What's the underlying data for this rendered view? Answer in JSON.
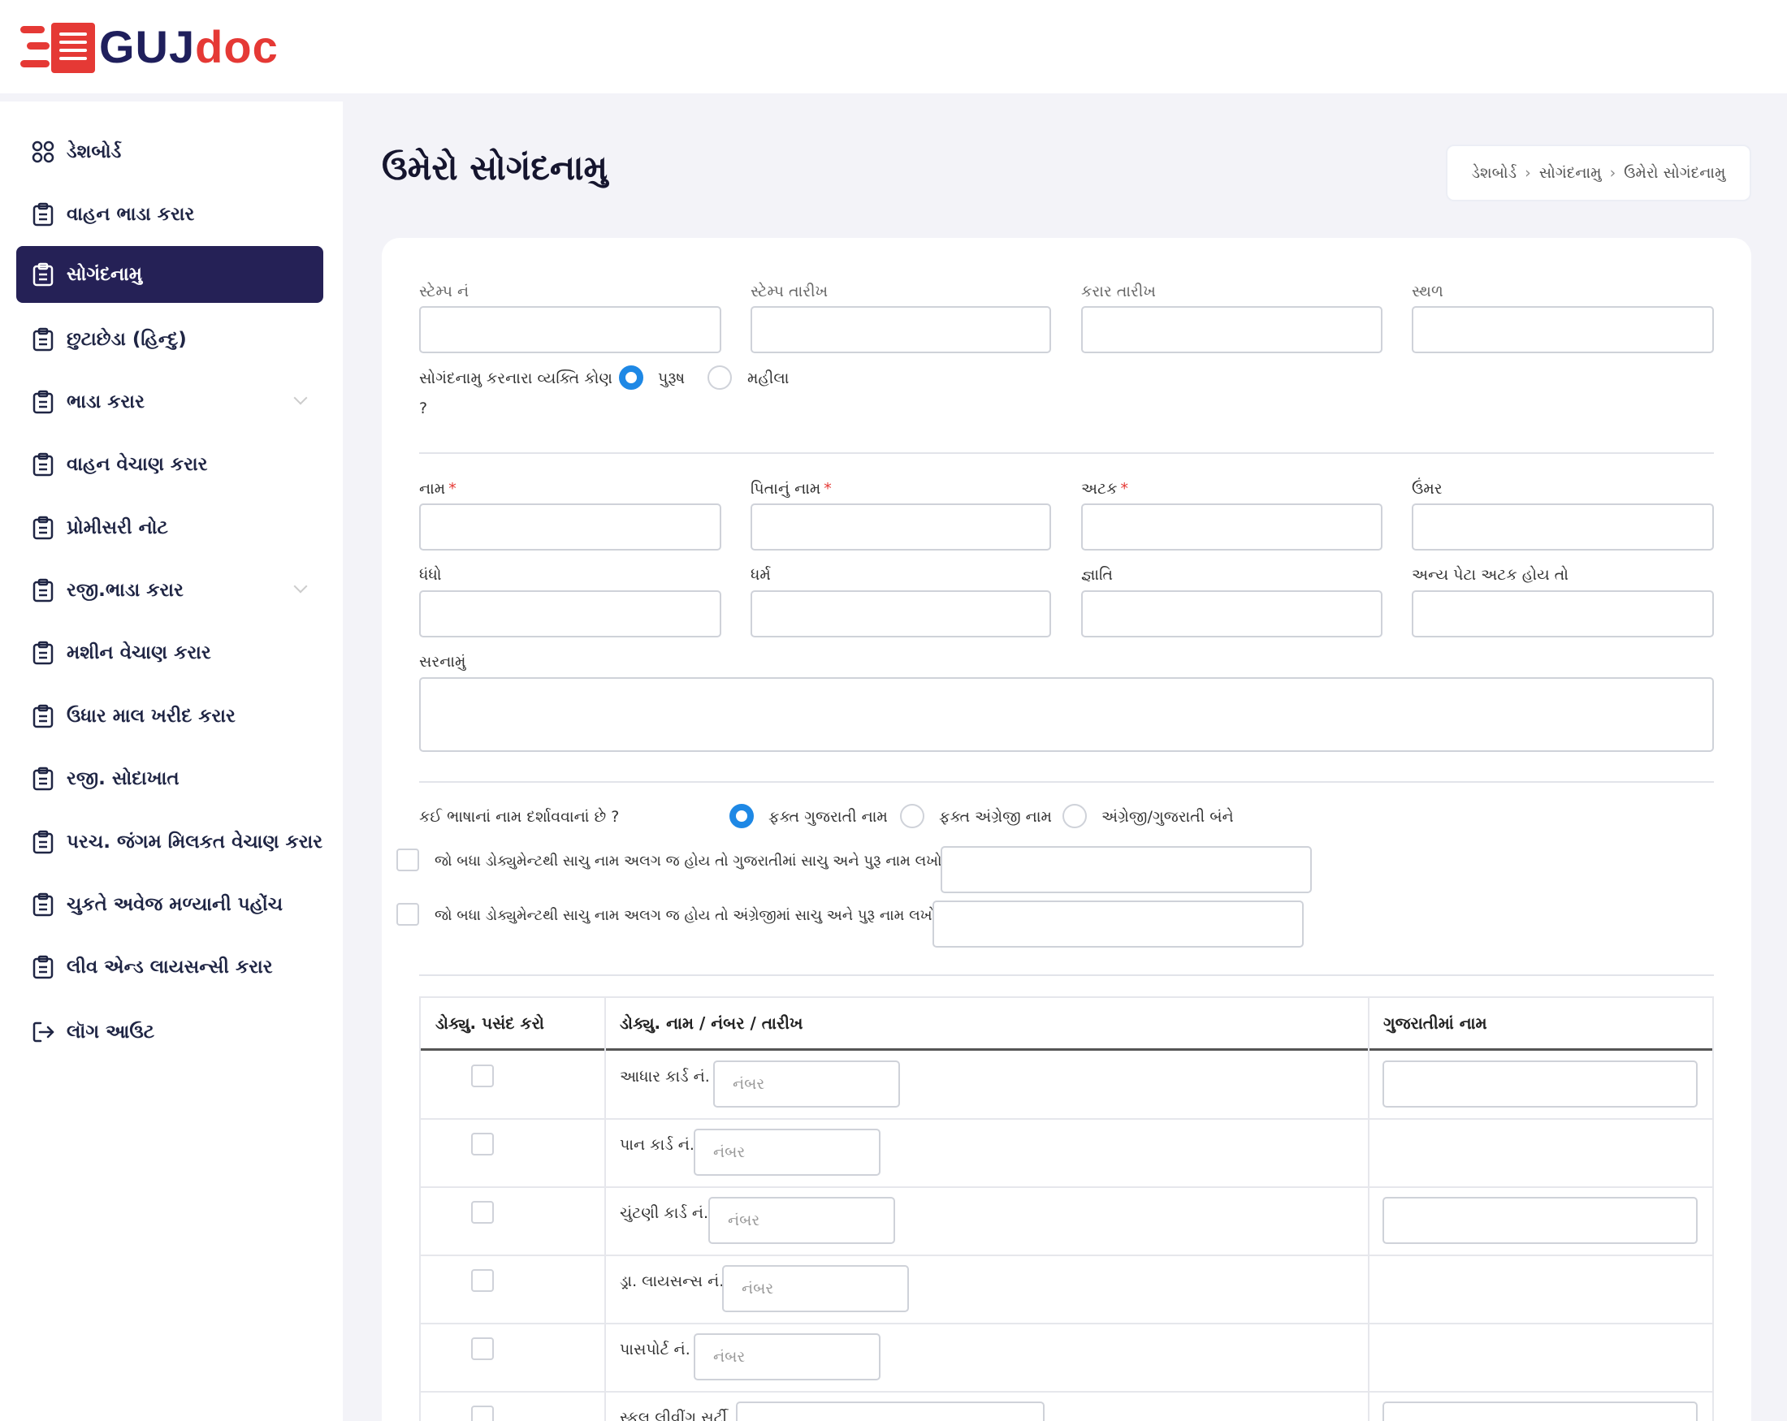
{
  "brand": {
    "name_part1": "GUJ",
    "name_part2": "doc",
    "color_dark": "#1f1f5c",
    "color_red": "#e53935"
  },
  "sidebar": {
    "items": [
      {
        "label": "ડેશબોર્ડ",
        "icon": "grid-icon"
      },
      {
        "label": "વાહન ભાડા કરાર",
        "icon": "clipboard-icon"
      },
      {
        "label": "સોગંદનામુ",
        "icon": "clipboard-icon",
        "active": true
      },
      {
        "label": "છુટાછેડા (હિન્દુ)",
        "icon": "clipboard-icon"
      },
      {
        "label": "ભાડા કરાર",
        "icon": "clipboard-icon",
        "expandable": true
      },
      {
        "label": "વાહન વેચાણ કરાર",
        "icon": "clipboard-icon"
      },
      {
        "label": "પ્રોમીસરી નોટ",
        "icon": "clipboard-icon"
      },
      {
        "label": "રજી.ભાડા કરાર",
        "icon": "clipboard-icon",
        "expandable": true
      },
      {
        "label": "મશીન વેચાણ કરાર",
        "icon": "clipboard-icon"
      },
      {
        "label": "ઉધાર માલ ખરીદ કરાર",
        "icon": "clipboard-icon"
      },
      {
        "label": "રજી. સોદાખાત",
        "icon": "clipboard-icon"
      },
      {
        "label": "પરચ. જંગમ મિલકત વેચાણ કરાર",
        "icon": "clipboard-icon"
      },
      {
        "label": "ચુકતે અવેજ મળ્યાની પહોંચ",
        "icon": "clipboard-icon"
      },
      {
        "label": "લીવ એન્ડ લાયસન્સી કરાર",
        "icon": "clipboard-icon"
      },
      {
        "label": "લૉગ આઉટ",
        "icon": "logout-icon"
      }
    ],
    "active_color": "#252156"
  },
  "page": {
    "title": "ઉમેરો સોગંદનામુ"
  },
  "breadcrumb": {
    "items": [
      "ડેશબોર્ડ",
      "સોગંદનામુ",
      "ઉમેરો સોગંદનામુ"
    ]
  },
  "form": {
    "stamp_no_label": "સ્ટેમ્પ નં",
    "stamp_date_label": "સ્ટેમ્પ તારીખ",
    "agreement_date_label": "કરાર તારીખ",
    "place_label": "સ્થળ",
    "deponent_question_label": "સોગંદનામુ કરનારા વ્યક્તિ કોણ",
    "deponent_question_mark": "?",
    "gender_options": [
      "પુરૂષ",
      "મહીલા"
    ],
    "gender_selected": "પુરૂષ",
    "name_label": "નામ",
    "father_name_label": "પિતાનું નામ",
    "surname_label": "અટક",
    "age_label": "ઉંમર",
    "occupation_label": "ધંધો",
    "religion_label": "ધર્મ",
    "caste_label": "જ્ઞાતિ",
    "other_surname_label": "અન્ય પેટા અટક હોય તો",
    "address_label": "સરનામું",
    "required_mark": "*",
    "language_question": "કઈ ભાષાનાં નામ દર્શાવવાનાં છે ?",
    "language_options": [
      "ફક્ત ગુજરાતી નામ",
      "ફક્ત અંગ્રેજી નામ",
      "અંગ્રેજી/ગુજરાતી બંને"
    ],
    "language_selected": "ફક્ત ગુજરાતી નામ",
    "true_name_gujarati_label": "જો બધા ડોક્યુમેન્ટથી સાચુ નામ અલગ જ હોય તો ગુજરાતીમાં સાચુ અને પુરૂ નામ લખો",
    "true_name_english_label": "જો બધા ડોક્યુમેન્ટથી સાચુ નામ અલગ જ હોય તો અંગ્રેજીમાં સાચુ અને પુરૂ નામ લખો"
  },
  "docs_table": {
    "headers": [
      "ડોક્યુ. પસંદ કરો",
      "ડોક્યુ. નામ / નંબર / તારીખ",
      "ગુજરાતીમાં નામ"
    ],
    "number_placeholder": "નંબર",
    "rows": [
      {
        "label": "આધાર કાર્ડ નં.",
        "has_gujarati_name": true
      },
      {
        "label": "પાન કાર્ડ નં.",
        "has_gujarati_name": false
      },
      {
        "label": "ચુંટણી કાર્ડ નં.",
        "has_gujarati_name": true
      },
      {
        "label": "ડ્રા. લાયસન્સ નં.",
        "has_gujarati_name": false
      },
      {
        "label": "પાસપોર્ટ નં.",
        "has_gujarati_name": false
      },
      {
        "label": "સ્કુલ લીવીંગ સર્ટી",
        "has_gujarati_name": true
      }
    ]
  },
  "colors": {
    "radio_selected": "#1e88e5",
    "required": "#e53935"
  }
}
